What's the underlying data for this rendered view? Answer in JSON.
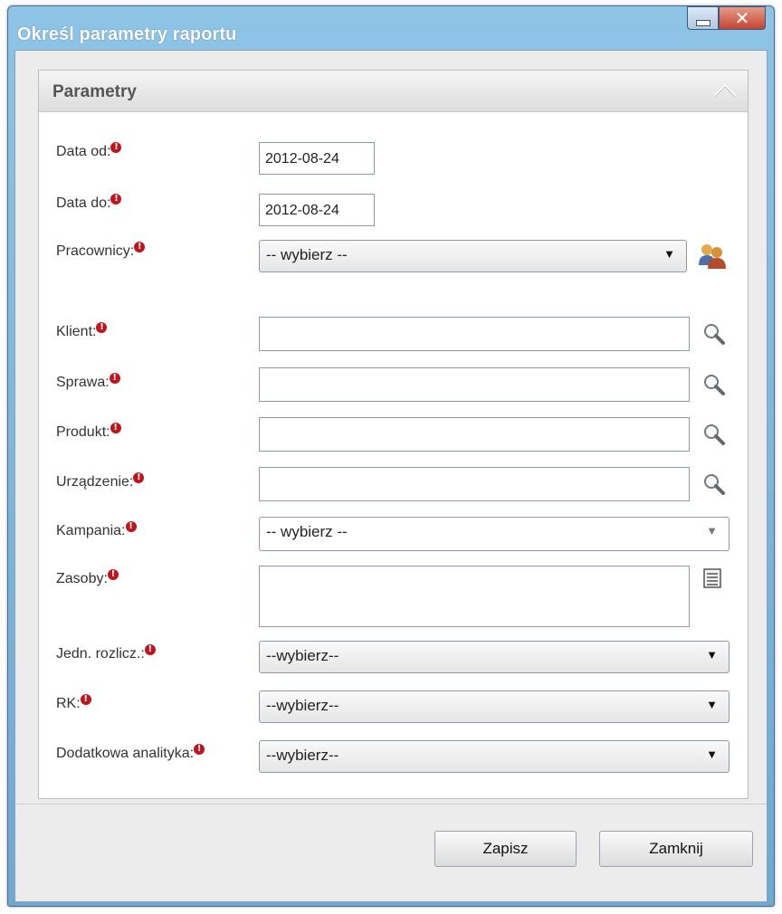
{
  "window": {
    "title": "Określ parametry raportu"
  },
  "panel": {
    "title": "Parametry"
  },
  "form": {
    "date_from": {
      "label": "Data od:",
      "value": "2012-08-24"
    },
    "date_to": {
      "label": "Data do:",
      "value": "2012-08-24"
    },
    "employees": {
      "label": "Pracownicy:",
      "value": "-- wybierz --",
      "icon": "users-icon"
    },
    "client": {
      "label": "Klient:",
      "value": "",
      "icon": "search-icon"
    },
    "case": {
      "label": "Sprawa:",
      "value": "",
      "icon": "search-icon"
    },
    "product": {
      "label": "Produkt:",
      "value": "",
      "icon": "search-icon"
    },
    "device": {
      "label": "Urządzenie:",
      "value": "",
      "icon": "search-icon"
    },
    "campaign": {
      "label": "Kampania:",
      "value": "-- wybierz --"
    },
    "resources": {
      "label": "Zasoby:",
      "value": "",
      "icon": "list-icon"
    },
    "billing_unit": {
      "label": "Jedn. rozlicz.:",
      "value": "--wybierz--"
    },
    "rk": {
      "label": "RK:",
      "value": "--wybierz--"
    },
    "extra_analytics": {
      "label": "Dodatkowa analityka:",
      "value": "--wybierz--"
    }
  },
  "buttons": {
    "save": "Zapisz",
    "close": "Zamknij"
  },
  "colors": {
    "titlebar": "#7fb8df",
    "required": "#c0151c"
  }
}
